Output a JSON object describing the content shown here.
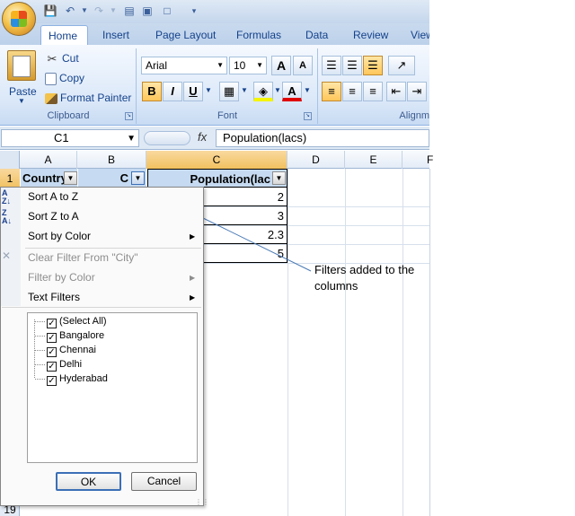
{
  "ribbon": {
    "tabs": [
      "Home",
      "Insert",
      "Page Layout",
      "Formulas",
      "Data",
      "Review",
      "View"
    ],
    "clipboard": {
      "paste": "Paste",
      "cut": "Cut",
      "copy": "Copy",
      "format_painter": "Format Painter",
      "label": "Clipboard"
    },
    "font": {
      "name": "Arial",
      "size": "10",
      "grow": "A",
      "shrink": "A",
      "bold": "B",
      "italic": "I",
      "underline": "U",
      "color_a": "A",
      "label": "Font"
    },
    "alignment": {
      "label": "Alignm"
    }
  },
  "formula_bar": {
    "name_box": "C1",
    "fx": "fx",
    "formula": "Population(lacs)"
  },
  "columns": [
    "A",
    "B",
    "C",
    "D",
    "E",
    "F"
  ],
  "rows": [
    "1",
    "19"
  ],
  "headers": {
    "a1": "Country",
    "b1": "C",
    "c1": "Population(lac"
  },
  "values": [
    "2",
    "3",
    "2.3",
    "5"
  ],
  "filter_menu": {
    "sort_az": "Sort A to Z",
    "sort_za": "Sort Z to A",
    "sort_color": "Sort by Color",
    "clear_filter": "Clear Filter From \"City\"",
    "filter_color": "Filter by Color",
    "text_filters": "Text Filters",
    "items": [
      "(Select All)",
      "Bangalore",
      "Chennai",
      "Delhi",
      "Hyderabad"
    ],
    "ok": "OK",
    "cancel": "Cancel"
  },
  "annotation": "Filters added to the columns",
  "colors": {
    "accent": "#15428b",
    "header_fill": "#c6dbf1",
    "selection": "#f1c15f"
  }
}
